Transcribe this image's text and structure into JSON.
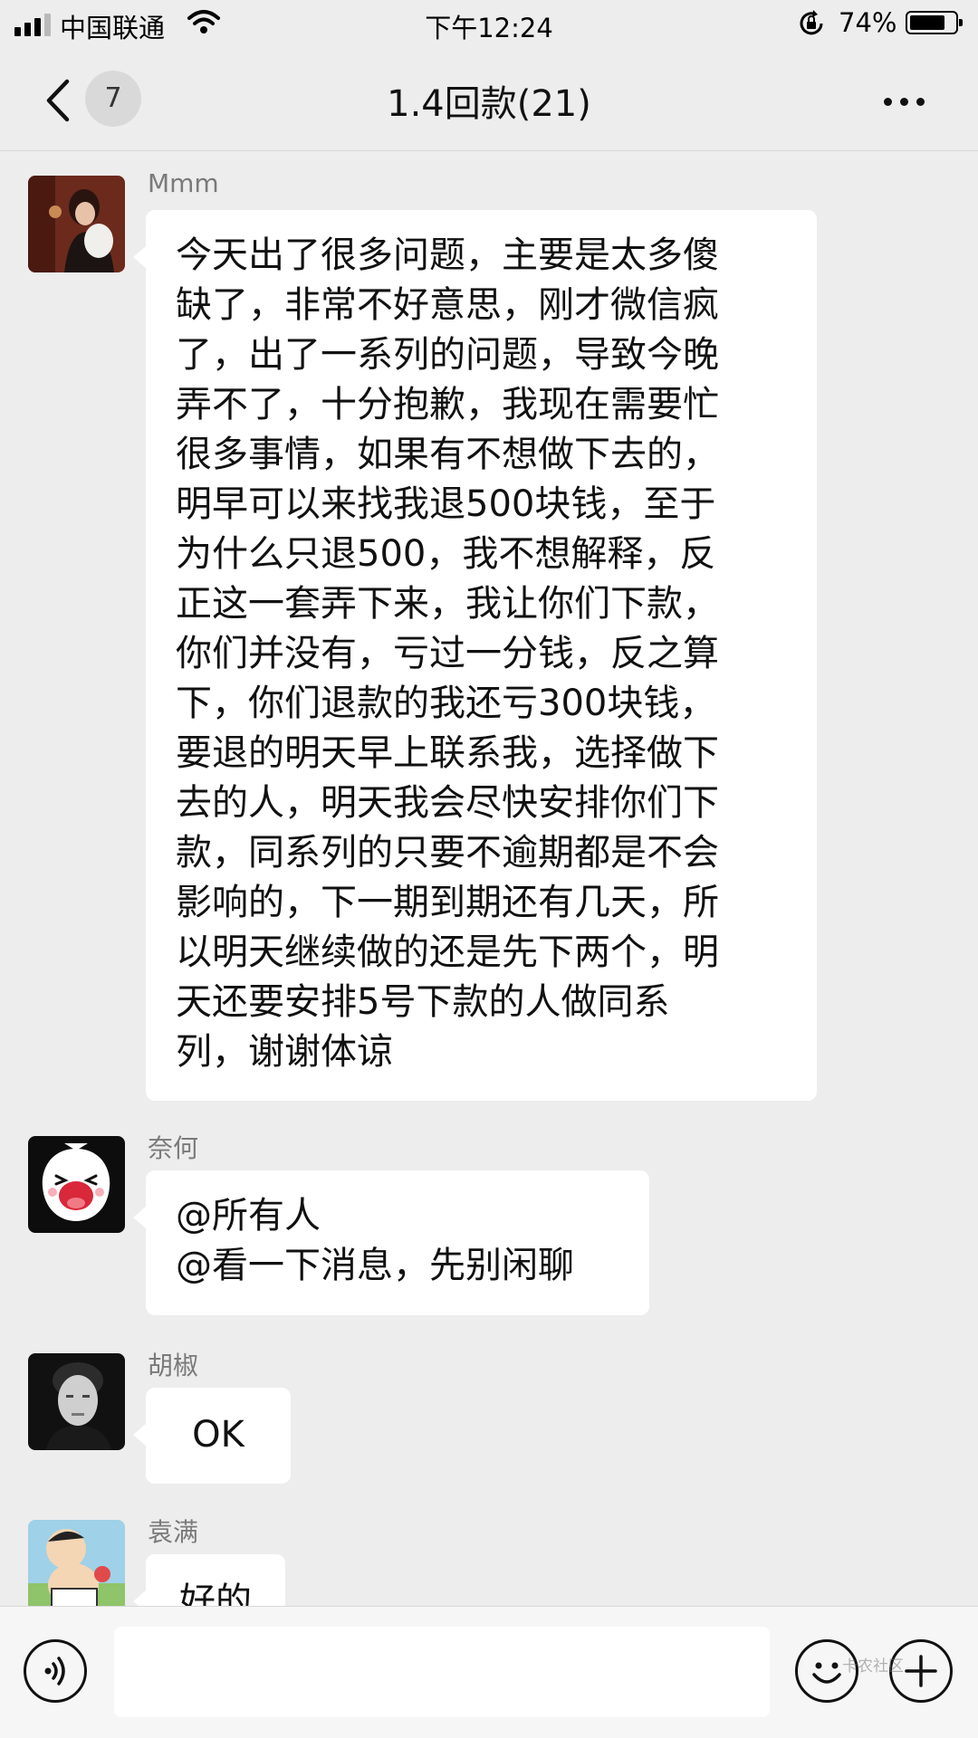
{
  "status_bar": {
    "carrier": "中国联通",
    "time": "下午12:24",
    "battery": "74%",
    "battery_level": 0.74
  },
  "nav": {
    "unread_count": "7",
    "title": "1.4回款(21)"
  },
  "messages": [
    {
      "sender": "Mmm",
      "lines": [
        "今天出了很多问题，主要是太多傻",
        "缺了，非常不好意思，刚才微信疯",
        "了，出了一系列的问题，导致今晚",
        "弄不了，十分抱歉，我现在需要忙",
        "很多事情，如果有不想做下去的，",
        "明早可以来找我退500块钱，至于",
        "为什么只退500，我不想解释，反",
        "正这一套弄下来，我让你们下款，",
        "你们并没有，亏过一分钱，反之算",
        "下，你们退款的我还亏300块钱，",
        "要退的明天早上联系我，选择做下",
        "去的人，明天我会尽快安排你们下",
        "款，同系列的只要不逾期都是不会",
        "影响的，下一期到期还有几天，所",
        "以明天继续做的还是先下两个，明",
        "天还要安排5号下款的人做同系",
        "列，谢谢体谅"
      ]
    },
    {
      "sender": "奈何",
      "lines": [
        "@所有人",
        "@看一下消息，先别闲聊"
      ]
    },
    {
      "sender": "胡椒",
      "lines": [
        "OK"
      ]
    },
    {
      "sender": "袁满",
      "lines": [
        "好的"
      ]
    }
  ],
  "watermark": "卡农社区",
  "icons": {
    "back": "chevron-left-icon",
    "more": "more-dots-icon",
    "voice": "voice-icon",
    "emoji": "emoji-icon",
    "add": "plus-icon"
  }
}
